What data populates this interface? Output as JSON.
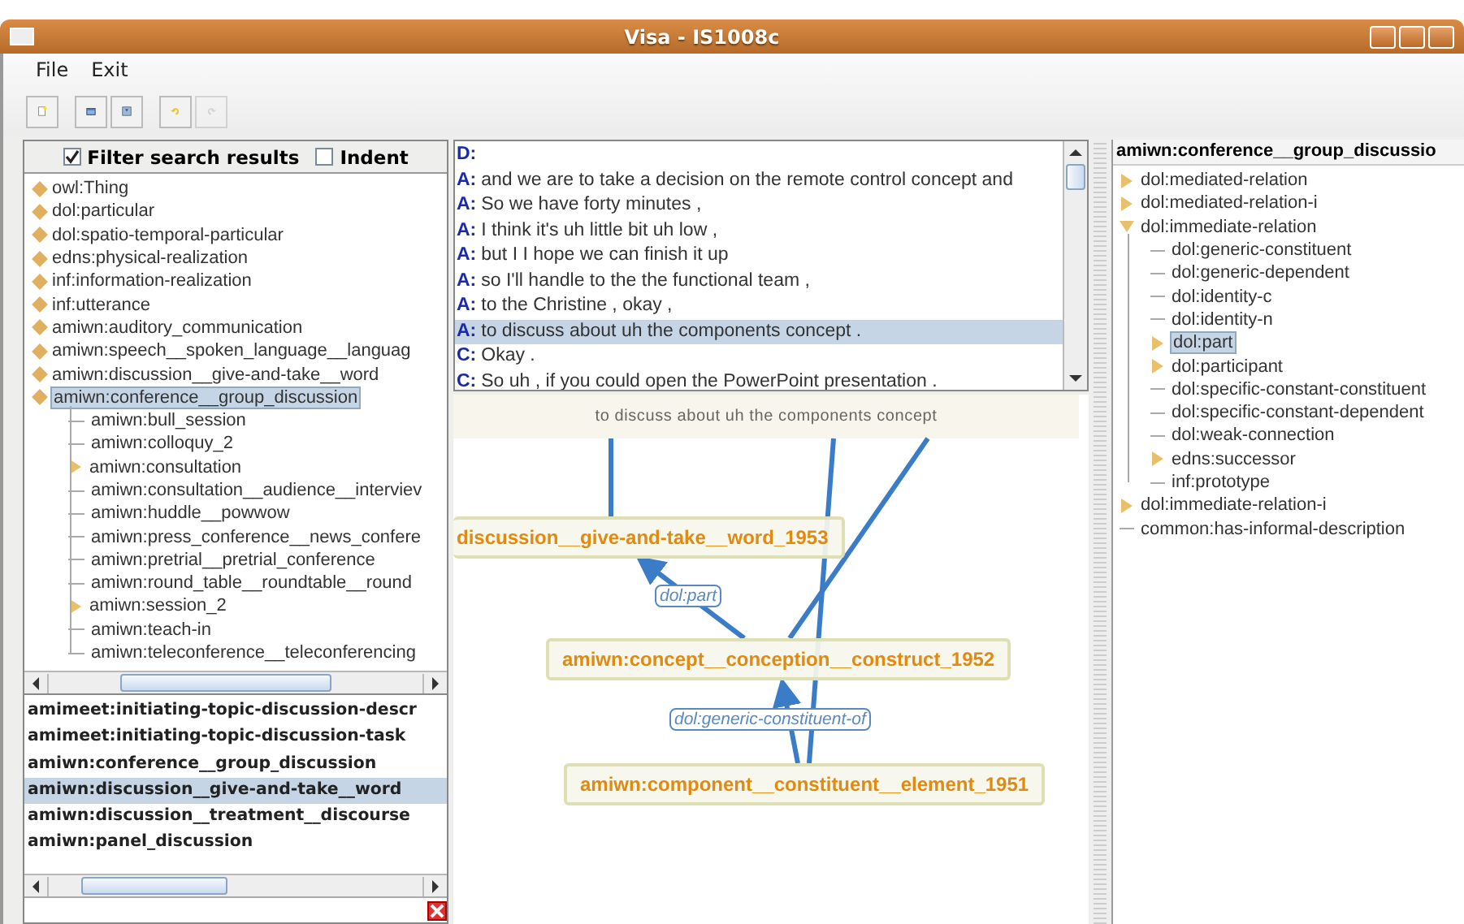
{
  "window": {
    "title": "Visa - IS1008c"
  },
  "menu": [
    "File",
    "Exit"
  ],
  "toolbar": [
    {
      "kind": "new",
      "disabled": false
    },
    {
      "kind": "open",
      "disabled": false
    },
    {
      "kind": "save",
      "disabled": false
    },
    {
      "kind": "undo",
      "disabled": false
    },
    {
      "kind": "redo",
      "disabled": true
    }
  ],
  "filter": {
    "filter_label": "Filter search results",
    "filter_checked": true,
    "indent_label": "Indent",
    "indent_checked": false
  },
  "concept_tree": [
    {
      "label": "owl:Thing",
      "selected": false
    },
    {
      "label": "dol:particular",
      "selected": false
    },
    {
      "label": "dol:spatio-temporal-particular",
      "selected": false
    },
    {
      "label": "edns:physical-realization",
      "selected": false
    },
    {
      "label": "inf:information-realization",
      "selected": false
    },
    {
      "label": "inf:utterance",
      "selected": false
    },
    {
      "label": "amiwn:auditory_communication",
      "selected": false
    },
    {
      "label": "amiwn:speech__spoken_language__languag",
      "selected": false
    },
    {
      "label": "amiwn:discussion__give-and-take__word",
      "selected": false
    },
    {
      "label": "amiwn:conference__group_discussion",
      "selected": true,
      "children": [
        {
          "label": "amiwn:bull_session",
          "expandable": false,
          "selected": false
        },
        {
          "label": "amiwn:colloquy_2",
          "expandable": false,
          "selected": false
        },
        {
          "label": "amiwn:consultation",
          "expandable": true,
          "selected": false
        },
        {
          "label": "amiwn:consultation__audience__interviev",
          "expandable": false,
          "selected": false
        },
        {
          "label": "amiwn:huddle__powwow",
          "expandable": false,
          "selected": false
        },
        {
          "label": "amiwn:press_conference__news_confere",
          "expandable": false,
          "selected": false
        },
        {
          "label": "amiwn:pretrial__pretrial_conference",
          "expandable": false,
          "selected": false
        },
        {
          "label": "amiwn:round_table__roundtable__round",
          "expandable": false,
          "selected": false
        },
        {
          "label": "amiwn:session_2",
          "expandable": true,
          "selected": false
        },
        {
          "label": "amiwn:teach-in",
          "expandable": false,
          "selected": false
        },
        {
          "label": "amiwn:teleconference__teleconferencing",
          "expandable": false,
          "selected": false
        }
      ]
    }
  ],
  "search_results": [
    {
      "label": "amimeet:initiating-topic-discussion-descr",
      "selected": false
    },
    {
      "label": "amimeet:initiating-topic-discussion-task",
      "selected": false
    },
    {
      "label": "amiwn:conference__group_discussion",
      "selected": false
    },
    {
      "label": "amiwn:discussion__give-and-take__word",
      "selected": true
    },
    {
      "label": "amiwn:discussion__treatment__discourse",
      "selected": false
    },
    {
      "label": "amiwn:panel_discussion",
      "selected": false
    }
  ],
  "transcript": [
    {
      "speaker": "D:",
      "selected": false
    },
    {
      "speaker": "A:",
      "text": "and we are to take a decision on the remote control concept and",
      "selected": false
    },
    {
      "speaker": "A:",
      "text": "So we have forty minutes ,",
      "selected": false
    },
    {
      "speaker": "A:",
      "text": "I think it's uh little bit uh low ,",
      "selected": false
    },
    {
      "speaker": "A:",
      "text": "but I I hope we can finish it up",
      "selected": false
    },
    {
      "speaker": "A:",
      "text": "so I'll handle to the the functional team ,",
      "selected": false
    },
    {
      "speaker": "A:",
      "text": "to the Christine , okay ,",
      "selected": false
    },
    {
      "speaker": "A:",
      "text": "to discuss about uh the components concept .",
      "selected": true
    },
    {
      "speaker": "C:",
      "text": "Okay .",
      "selected": false
    },
    {
      "speaker": "C:",
      "text": "So uh , if you could open the PowerPoint presentation .",
      "selected": false
    }
  ],
  "graph": {
    "utterance": "to discuss about uh the components concept",
    "nodes": [
      {
        "label": "discussion__give-and-take__word_1953"
      },
      {
        "label": "amiwn:concept__conception__construct_1952"
      },
      {
        "label": "amiwn:component__constituent__element_1951"
      }
    ],
    "edge_labels": [
      "dol:part",
      "dol:generic-constituent-of"
    ]
  },
  "relations": {
    "header": "amiwn:conference__group_discussio",
    "items": [
      {
        "label": "dol:mediated-relation",
        "expandable": true,
        "expanded": false,
        "selected": false
      },
      {
        "label": "dol:mediated-relation-i",
        "expandable": true,
        "expanded": false,
        "selected": false
      },
      {
        "label": "dol:immediate-relation",
        "expandable": true,
        "expanded": true,
        "selected": false,
        "children": [
          {
            "label": "dol:generic-constituent",
            "expandable": false,
            "selected": false
          },
          {
            "label": "dol:generic-dependent",
            "expandable": false,
            "selected": false
          },
          {
            "label": "dol:identity-c",
            "expandable": false,
            "selected": false
          },
          {
            "label": "dol:identity-n",
            "expandable": false,
            "selected": false
          },
          {
            "label": "dol:part",
            "expandable": true,
            "expanded": false,
            "selected": true
          },
          {
            "label": "dol:participant",
            "expandable": true,
            "expanded": false,
            "selected": false
          },
          {
            "label": "dol:specific-constant-constituent",
            "expandable": false,
            "selected": false
          },
          {
            "label": "dol:specific-constant-dependent",
            "expandable": false,
            "selected": false
          },
          {
            "label": "dol:weak-connection",
            "expandable": false,
            "selected": false
          },
          {
            "label": "edns:successor",
            "expandable": true,
            "expanded": false,
            "selected": false
          },
          {
            "label": "inf:prototype",
            "expandable": false,
            "selected": false
          }
        ]
      },
      {
        "label": "dol:immediate-relation-i",
        "expandable": true,
        "expanded": false,
        "selected": false
      },
      {
        "label": "common:has-informal-description",
        "expandable": false,
        "selected": false
      }
    ]
  }
}
